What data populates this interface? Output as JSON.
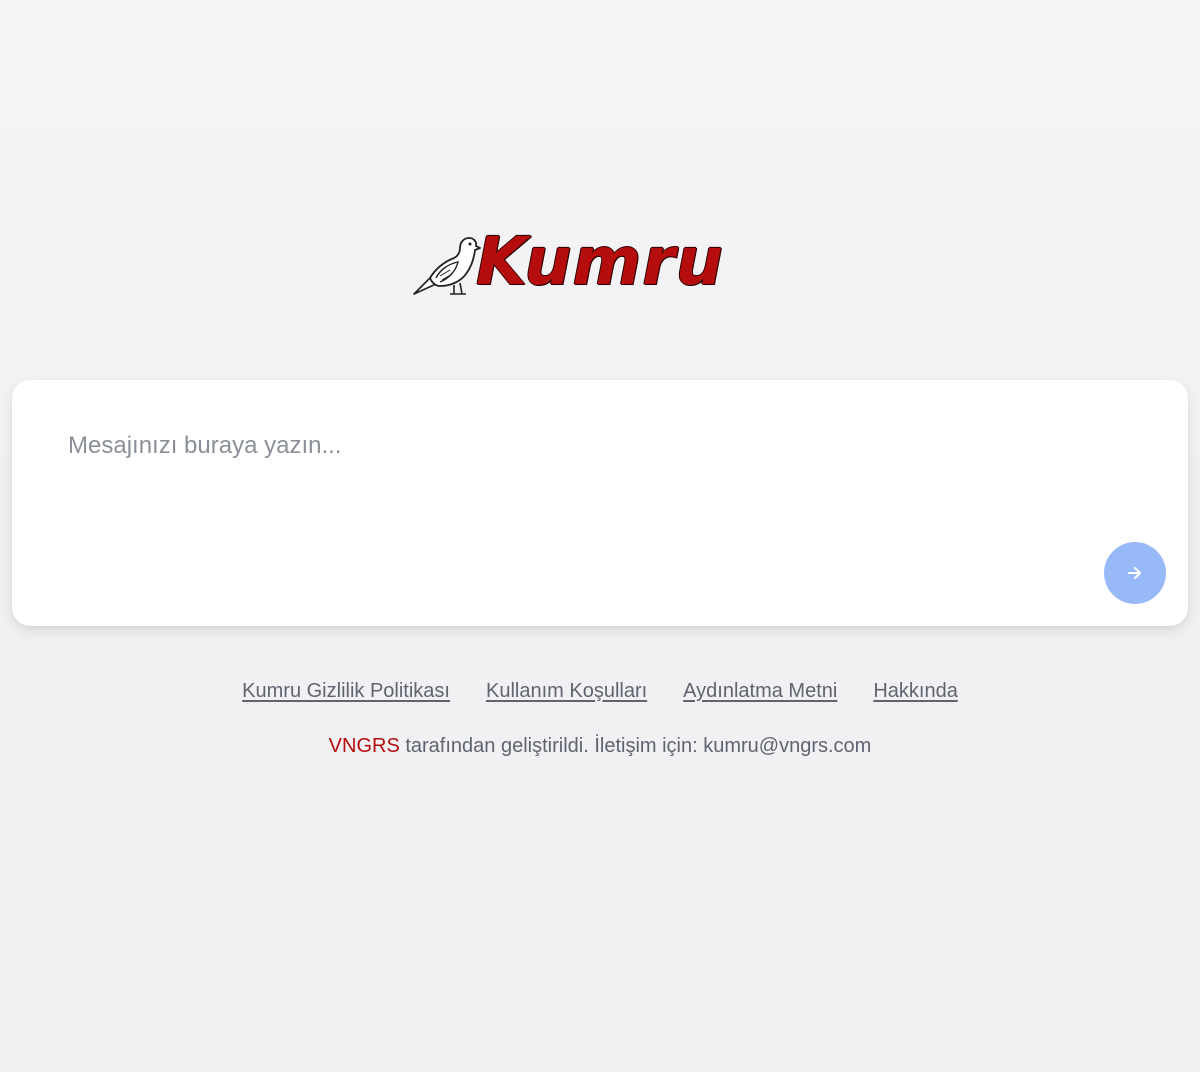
{
  "logo": {
    "text": "Kumru",
    "icon": "dove-icon",
    "color": "#b50d0d"
  },
  "chat": {
    "placeholder": "Mesajınızı buraya yazın...",
    "value": "",
    "send_icon": "arrow-right-icon",
    "send_button_color": "#98b9f7"
  },
  "footer": {
    "links": [
      {
        "label": "Kumru Gizlilik Politikası"
      },
      {
        "label": "Kullanım Koşulları"
      },
      {
        "label": "Aydınlatma Metni"
      },
      {
        "label": "Hakkında"
      }
    ],
    "credit": {
      "brand": "VNGRS",
      "brand_color": "#b50d0d",
      "text": " tarafından geliştirildi. İletişim için: kumru@vngrs.com"
    }
  }
}
